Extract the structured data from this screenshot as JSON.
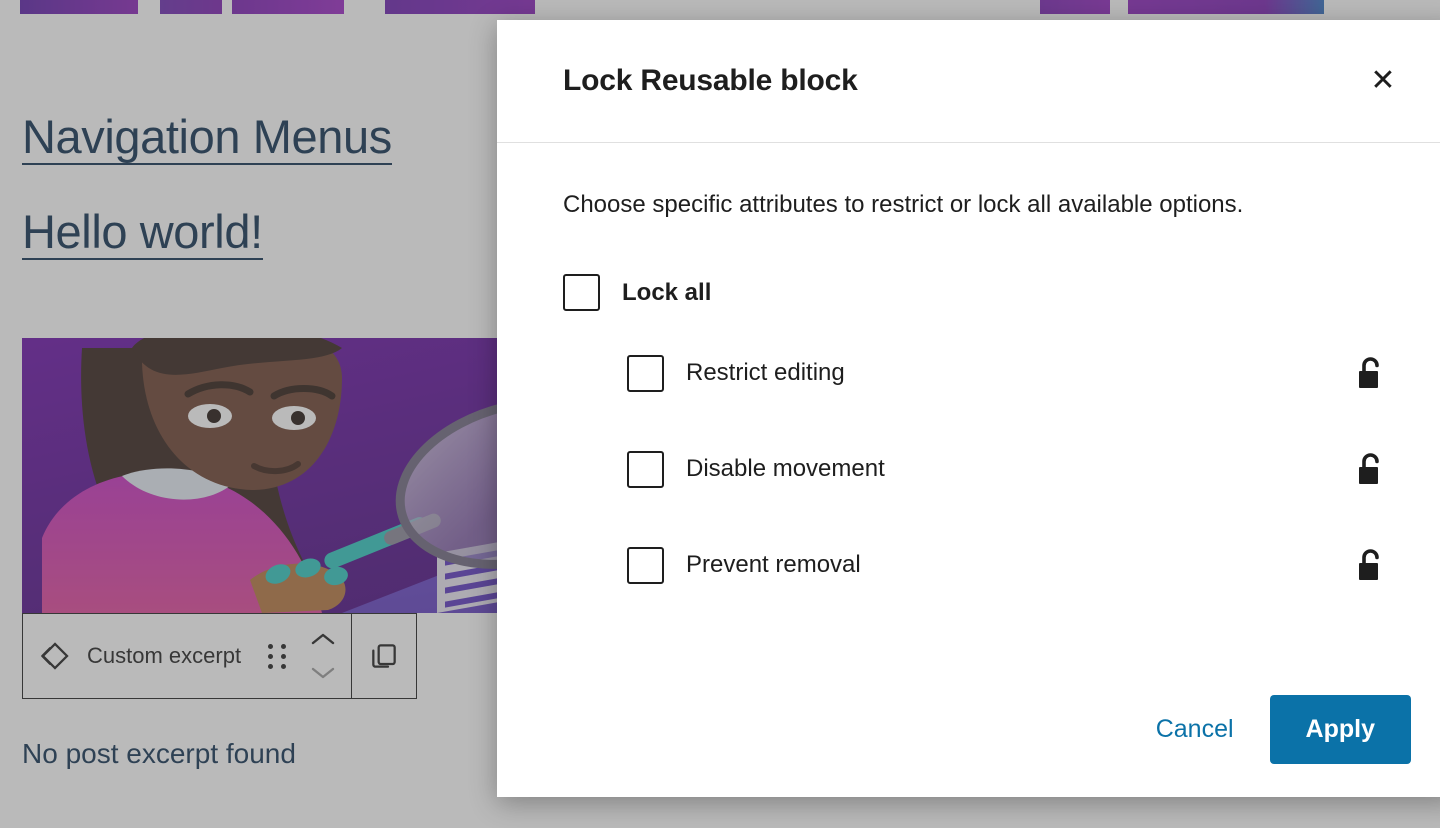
{
  "editor": {
    "post_links": [
      {
        "label": "Navigation Menus"
      },
      {
        "label": "Hello world!"
      }
    ],
    "featured_image_alt": "Illustration of a person inspecting data charts with a magnifying glass",
    "block_toolbar": {
      "block_icon_name": "block-diamond-icon",
      "block_label": "Custom excerpt",
      "drag_handle_name": "drag-handle-icon",
      "move_up_name": "chevron-up-icon",
      "move_down_name": "chevron-down-icon",
      "duplicate_name": "duplicate-icon"
    },
    "excerpt_notice": "No post excerpt found"
  },
  "modal": {
    "title": "Lock Reusable block",
    "close_label": "✕",
    "description": "Choose specific attributes to restrict or lock all available options.",
    "lock_all": {
      "label": "Lock all",
      "checked": false
    },
    "options": [
      {
        "label": "Restrict editing",
        "checked": false,
        "icon": "unlock-icon"
      },
      {
        "label": "Disable movement",
        "checked": false,
        "icon": "unlock-icon"
      },
      {
        "label": "Prevent removal",
        "checked": false,
        "icon": "unlock-icon"
      }
    ],
    "cancel_label": "Cancel",
    "apply_label": "Apply"
  },
  "colors": {
    "accent_blue": "#0b72a8",
    "link_navy": "#0e2f50",
    "text_dark": "#1e1e1e",
    "overlay_gray": "#9b9b9b"
  }
}
